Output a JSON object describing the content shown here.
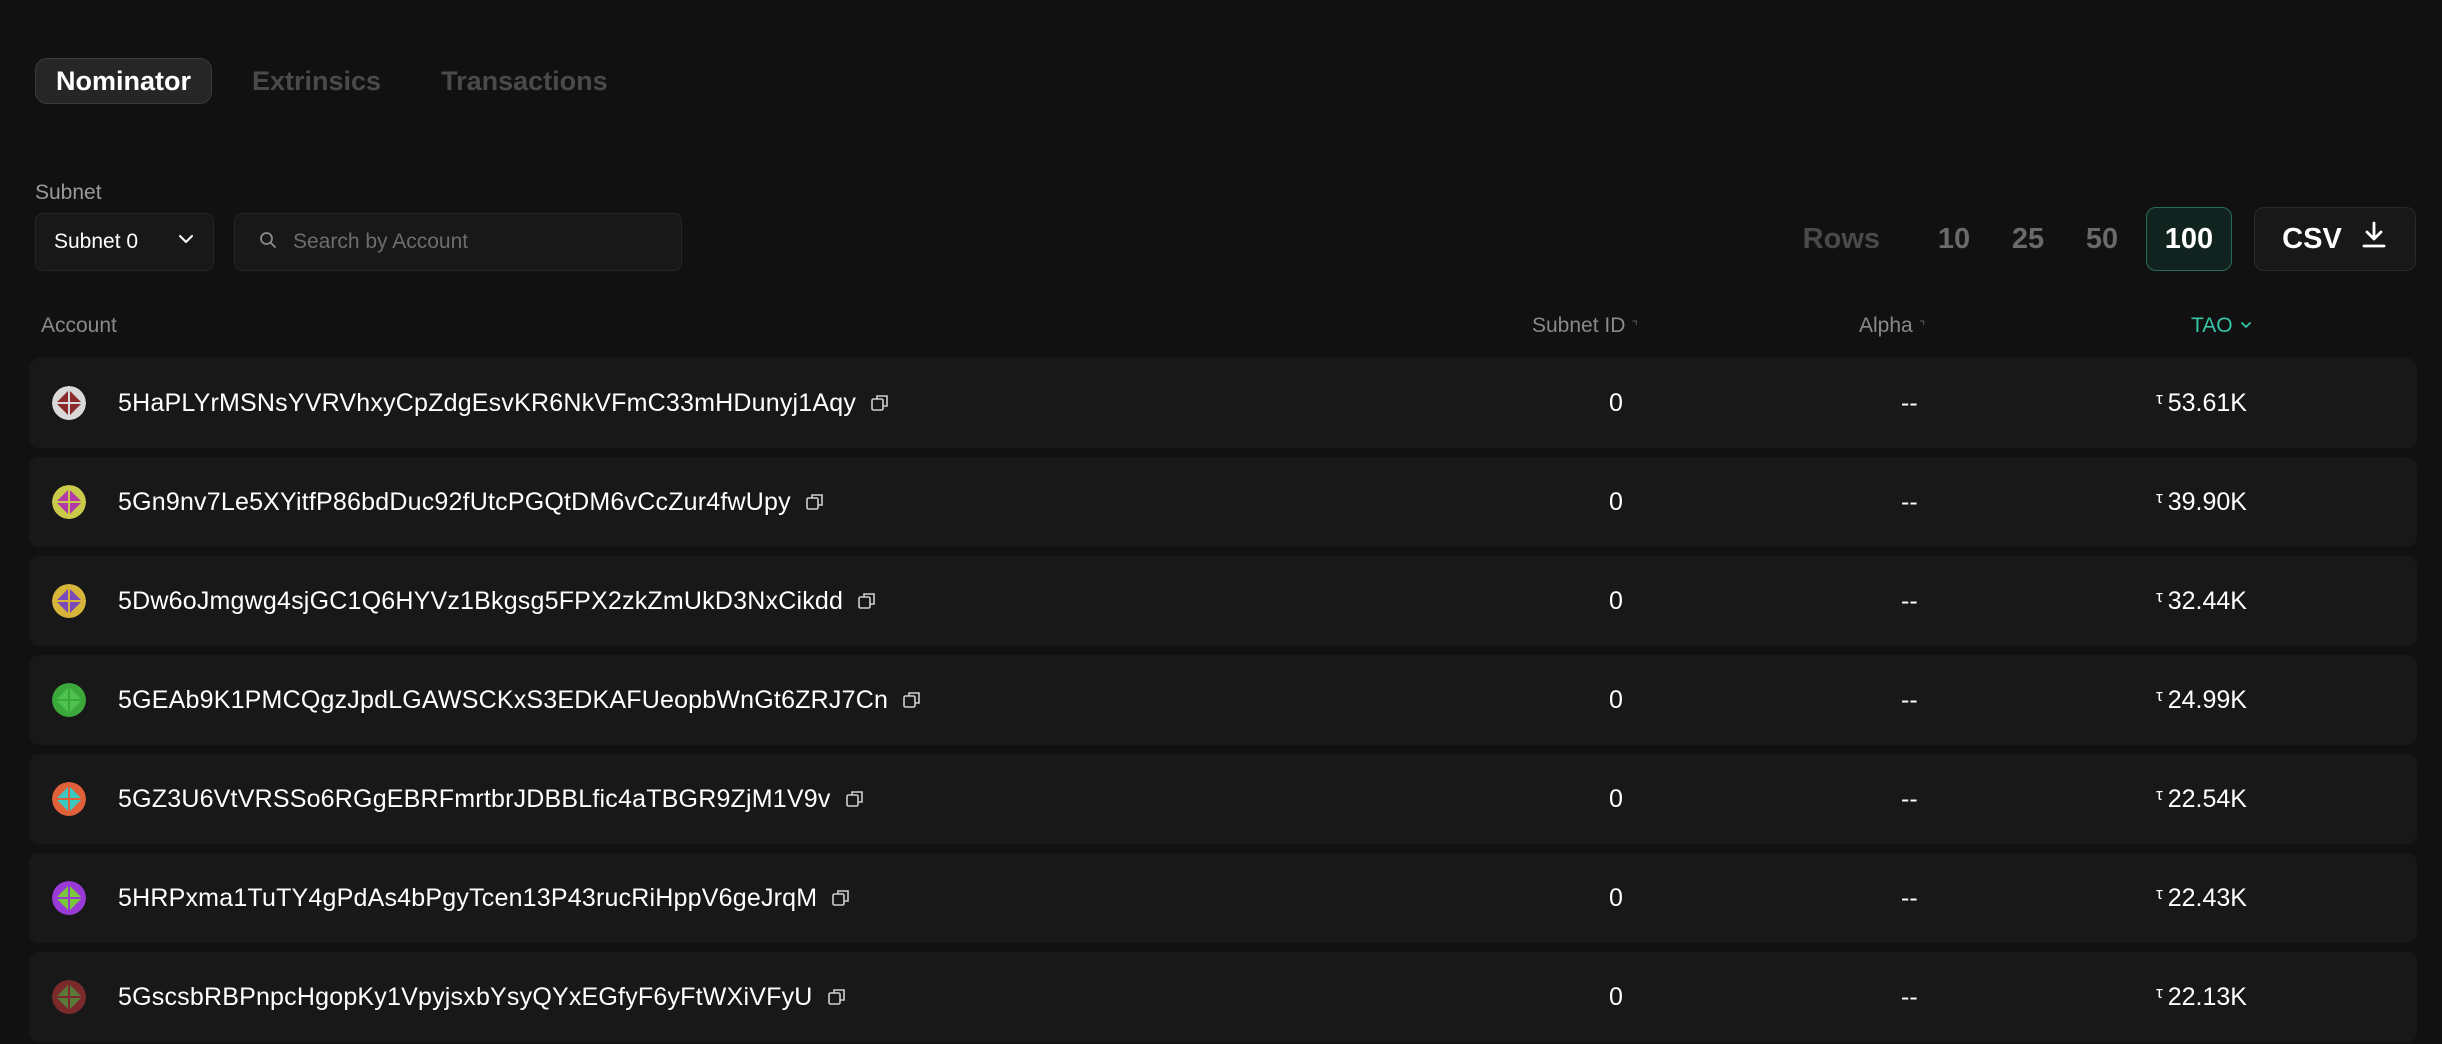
{
  "tabs": [
    {
      "label": "Nominator",
      "active": true
    },
    {
      "label": "Extrinsics",
      "active": false
    },
    {
      "label": "Transactions",
      "active": false
    }
  ],
  "filters": {
    "subnet_label": "Subnet",
    "subnet_value": "Subnet 0",
    "search_placeholder": "Search by Account"
  },
  "rows_control": {
    "label": "Rows",
    "options": [
      "10",
      "25",
      "50",
      "100"
    ],
    "selected": "100"
  },
  "csv_label": "CSV",
  "table": {
    "columns": {
      "account": "Account",
      "subnet_id": "Subnet ID",
      "alpha": "Alpha",
      "tao": "TAO"
    },
    "tao_symbol": "τ",
    "rows": [
      {
        "account": "5HaPLYrMSNsYVRVhxyCpZdgEsvKR6NkVFmC33mHDunyj1Aqy",
        "subnet_id": "0",
        "alpha": "--",
        "tao": "53.61K",
        "avatar_colors": [
          "#d9d9d9",
          "#8a2a2a"
        ]
      },
      {
        "account": "5Gn9nv7Le5XYitfP86bdDuc92fUtcPGQtDM6vCcZur4fwUpy",
        "subnet_id": "0",
        "alpha": "--",
        "tao": "39.90K",
        "avatar_colors": [
          "#c9c94a",
          "#b23aa8"
        ]
      },
      {
        "account": "5Dw6oJmgwg4sjGC1Q6HYVz1Bkgsg5FPX2zkZmUkD3NxCikdd",
        "subnet_id": "0",
        "alpha": "--",
        "tao": "32.44K",
        "avatar_colors": [
          "#d6b53a",
          "#7a4ab8"
        ]
      },
      {
        "account": "5GEAb9K1PMCQgzJpdLGAWSCKxS3EDKAFUeopbWnGt6ZRJ7Cn",
        "subnet_id": "0",
        "alpha": "--",
        "tao": "24.99K",
        "avatar_colors": [
          "#3aa83a",
          "#4ec24e"
        ]
      },
      {
        "account": "5GZ3U6VtVRSSo6RGgEBRFmrtbrJDBBLfic4aTBGR9ZjM1V9v",
        "subnet_id": "0",
        "alpha": "--",
        "tao": "22.54K",
        "avatar_colors": [
          "#e0603a",
          "#3ac8c0"
        ]
      },
      {
        "account": "5HRPxma1TuTY4gPdAs4bPgyTcen13P43rucRiHppV6geJrqM",
        "subnet_id": "0",
        "alpha": "--",
        "tao": "22.43K",
        "avatar_colors": [
          "#9a3ad6",
          "#7ac83a"
        ]
      },
      {
        "account": "5GscsbRBPnpcHgopKy1VpyjsxbYsyQYxEGfyF6yFtWXiVFyU",
        "subnet_id": "0",
        "alpha": "--",
        "tao": "22.13K",
        "avatar_colors": [
          "#7a2a2a",
          "#5a7a3a"
        ]
      }
    ]
  },
  "colors": {
    "background": "#111111",
    "row_background": "#181818",
    "accent": "#35c6a7"
  }
}
